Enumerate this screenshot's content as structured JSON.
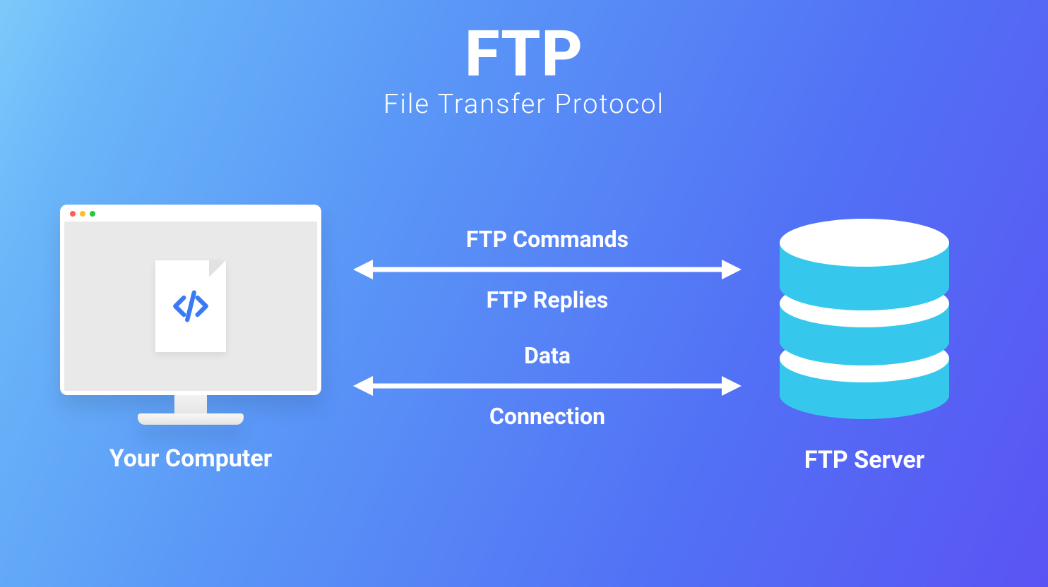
{
  "header": {
    "title": "FTP",
    "subtitle": "File Transfer Protocol"
  },
  "client": {
    "label": "Your Computer",
    "icon": "code-file-icon"
  },
  "server": {
    "label": "FTP Server",
    "icon": "database-icon"
  },
  "arrows": {
    "top": {
      "above": "FTP Commands",
      "below": "FTP Replies",
      "direction": "bidirectional"
    },
    "bottom": {
      "above": "Data",
      "below": "Connection",
      "direction": "bidirectional"
    }
  },
  "colors": {
    "arrow": "#ffffff",
    "db": "#35c8ec",
    "code": "#3a7af5"
  }
}
